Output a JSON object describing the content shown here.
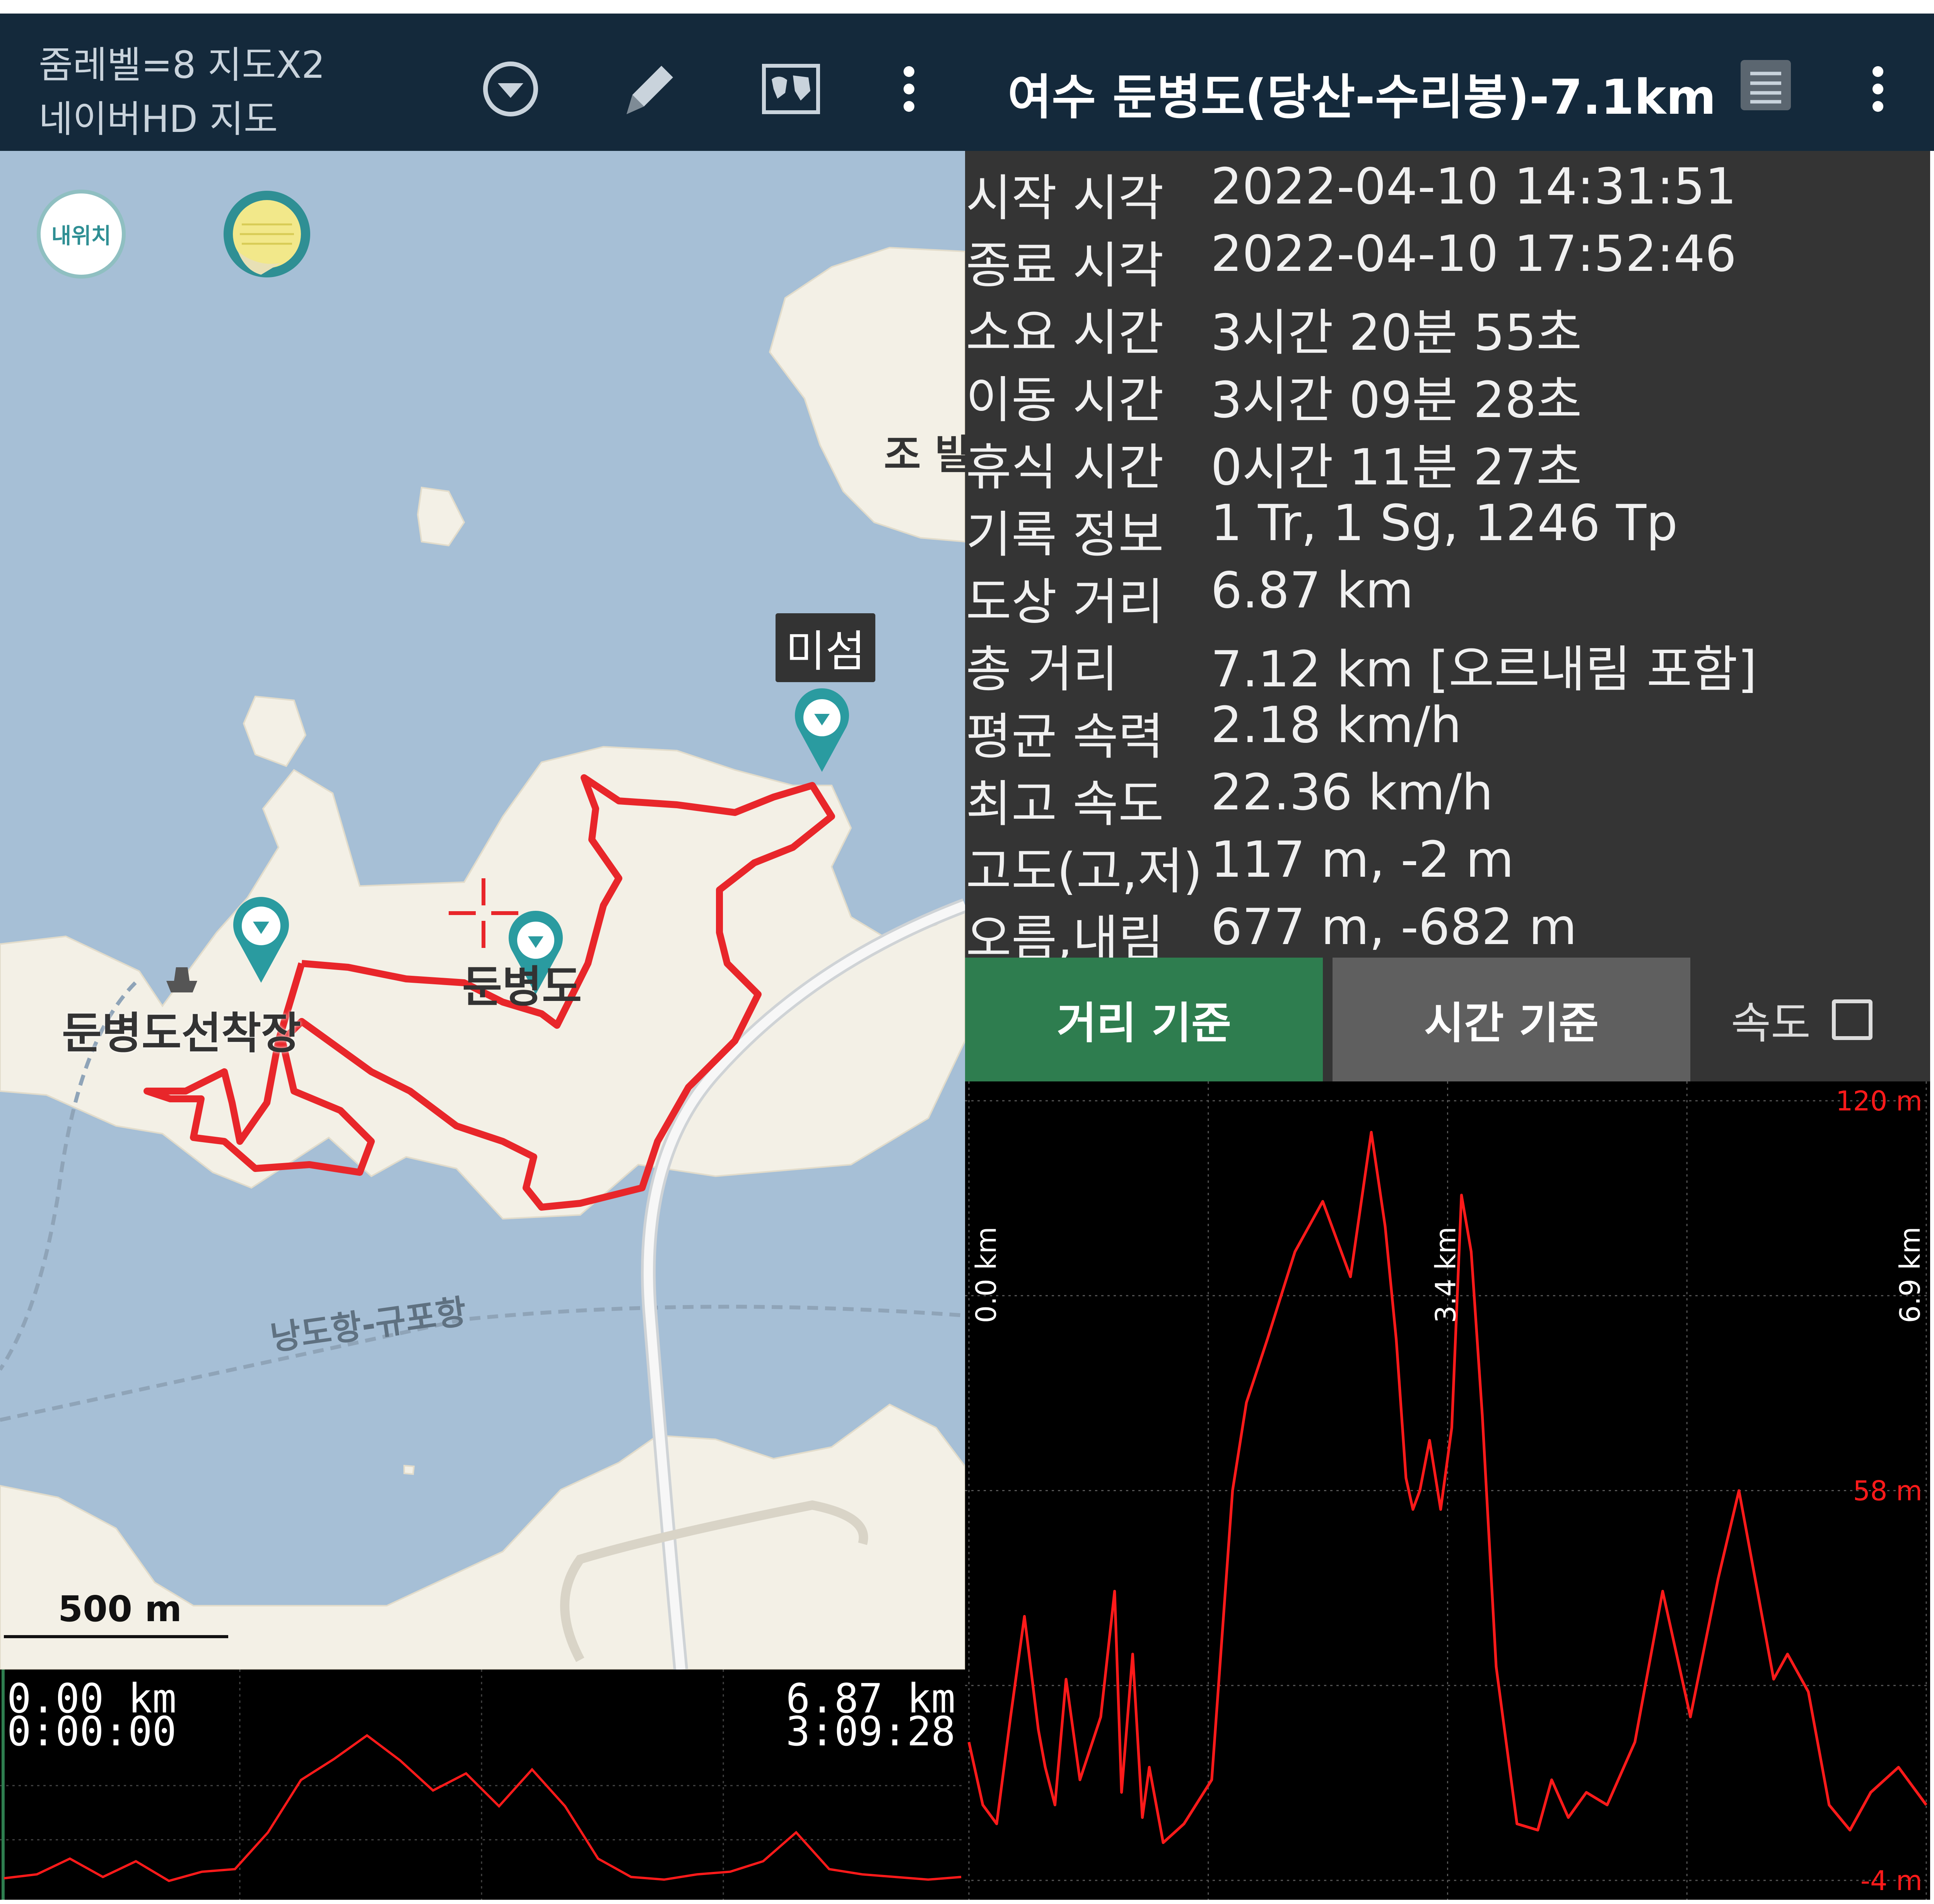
{
  "left_header": {
    "zoom_text": "줌레벨=8 지도X2",
    "map_source": "네이버HD 지도"
  },
  "map": {
    "my_location_label": "내위치",
    "labels": {
      "misum": "미섬",
      "jobal": "조 발",
      "dunbyeongdo": "둔병도",
      "dunbyeongdo_pier": "둔병도선착장",
      "ferry_route": "낭도항-규포항"
    },
    "scale_label": "500 m",
    "track_color": "#e8262a"
  },
  "mini_profile": {
    "start_distance": "0.00 km",
    "start_time": "0:00:00",
    "end_distance": "6.87 km",
    "end_time": "3:09:28"
  },
  "right_header": {
    "title": "여수 둔병도(당산-수리봉)-7.1km"
  },
  "stats": [
    {
      "label": "시작 시각",
      "value": "2022-04-10 14:31:51"
    },
    {
      "label": "종료 시각",
      "value": "2022-04-10 17:52:46"
    },
    {
      "label": "소요 시간",
      "value": "3시간 20분 55초"
    },
    {
      "label": "이동 시간",
      "value": "3시간 09분 28초"
    },
    {
      "label": "휴식 시간",
      "value": "0시간 11분 27초"
    },
    {
      "label": "기록 정보",
      "value": "1 Tr, 1 Sg, 1246 Tp"
    },
    {
      "label": "도상 거리",
      "value": "6.87 km"
    },
    {
      "label": "총 거리",
      "value": "7.12 km [오르내림 포함]"
    },
    {
      "label": "평균 속력",
      "value": "2.18 km/h"
    },
    {
      "label": "최고 속도",
      "value": "22.36 km/h"
    },
    {
      "label": "고도(고,저)",
      "value": "117 m, -2 m"
    },
    {
      "label": "오름,내림",
      "value": "677 m, -682 m"
    }
  ],
  "buttons": {
    "distance_basis": "거리 기준",
    "time_basis": "시간 기준",
    "speed_label": "속도",
    "distance_active_color": "#2e7d4f",
    "time_color": "#5f5f5f"
  },
  "chart_data": {
    "type": "line",
    "title": "",
    "xlabel": "",
    "ylabel": "",
    "x_tick_labels": [
      "0.0 km",
      "3.4 km",
      "6.9 km"
    ],
    "y_tick_labels": [
      "120 m",
      "58 m",
      "-4 m"
    ],
    "xlim": [
      0,
      6.9
    ],
    "ylim": [
      -4,
      120
    ],
    "line_color": "#ff1a1a",
    "grid": true,
    "series": [
      {
        "x": [
          0.0,
          0.1,
          0.2,
          0.3,
          0.4,
          0.5,
          0.55,
          0.62,
          0.7,
          0.8,
          0.95,
          1.05,
          1.1,
          1.18,
          1.25,
          1.3,
          1.4,
          1.55,
          1.75,
          1.9,
          2.0,
          2.15,
          2.35,
          2.55,
          2.75,
          2.9,
          3.0,
          3.08,
          3.15,
          3.2,
          3.25,
          3.32,
          3.4,
          3.48,
          3.55,
          3.62,
          3.7,
          3.8,
          3.95,
          4.1,
          4.2,
          4.32,
          4.45,
          4.6,
          4.8,
          5.0,
          5.2,
          5.4,
          5.55,
          5.7,
          5.8,
          5.9,
          6.05,
          6.2,
          6.35,
          6.5,
          6.7,
          6.9
        ],
        "y": [
          18,
          8,
          5,
          22,
          38,
          20,
          14,
          8,
          28,
          12,
          22,
          42,
          10,
          32,
          6,
          14,
          2,
          5,
          12,
          58,
          72,
          82,
          96,
          104,
          92,
          115,
          100,
          82,
          60,
          55,
          58,
          66,
          55,
          68,
          105,
          96,
          70,
          30,
          5,
          4,
          12,
          6,
          10,
          8,
          18,
          42,
          22,
          44,
          58,
          40,
          28,
          32,
          26,
          8,
          4,
          10,
          14,
          8
        ]
      }
    ]
  },
  "mini_chart": {
    "line_color": "#ff1a1a",
    "ylim": [
      -4,
      120
    ],
    "values": [
      5,
      8,
      20,
      6,
      18,
      3,
      10,
      12,
      40,
      80,
      96,
      114,
      95,
      72,
      85,
      60,
      88,
      60,
      20,
      6,
      4,
      8,
      10,
      18,
      40,
      12,
      8,
      6,
      4,
      6
    ]
  }
}
